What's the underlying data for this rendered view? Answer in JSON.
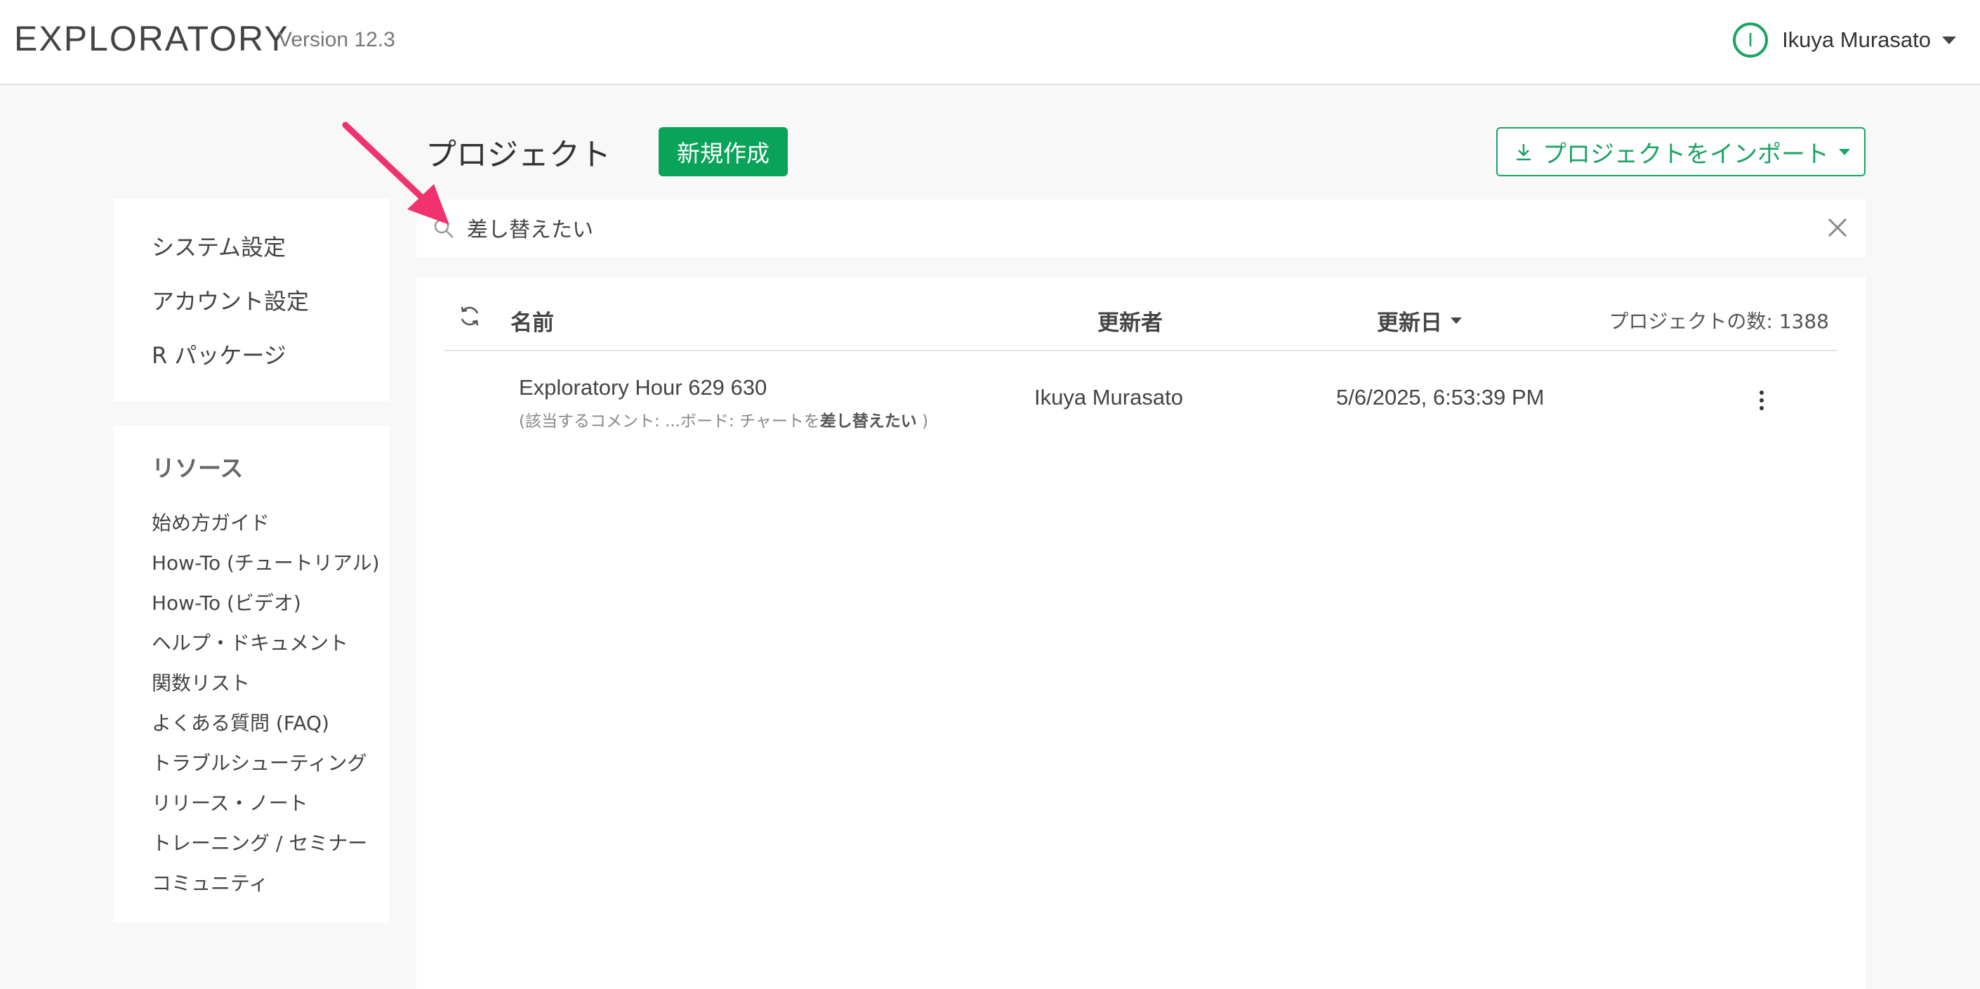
{
  "header": {
    "brand": "EXPLORATORY",
    "version": "Version 12.3",
    "user_initial": "I",
    "user_name": "Ikuya Murasato"
  },
  "sidebar": {
    "settings": [
      {
        "label": "システム設定"
      },
      {
        "label": "アカウント設定"
      },
      {
        "label": "R パッケージ"
      }
    ],
    "resources_title": "リソース",
    "resources": [
      {
        "label": "始め方ガイド"
      },
      {
        "label": "How-To (チュートリアル)"
      },
      {
        "label": "How-To (ビデオ)"
      },
      {
        "label": "ヘルプ・ドキュメント"
      },
      {
        "label": "関数リスト"
      },
      {
        "label": "よくある質問 (FAQ)"
      },
      {
        "label": "トラブルシューティング"
      },
      {
        "label": "リリース・ノート"
      },
      {
        "label": "トレーニング / セミナー"
      },
      {
        "label": "コミュニティ"
      }
    ]
  },
  "main": {
    "title": "プロジェクト",
    "new_button": "新規作成",
    "import_button": "プロジェクトをインポート",
    "search": {
      "value": "差し替えたい",
      "placeholder": ""
    },
    "columns": {
      "name": "名前",
      "updater": "更新者",
      "date": "更新日"
    },
    "project_count": "プロジェクトの数: 1388",
    "rows": [
      {
        "name": "Exploratory Hour 629 630",
        "comment_prefix": "(該当するコメント: ...ボード: チャートを",
        "comment_match": "差し替えたい",
        "comment_suffix": " )",
        "updater": "Ikuya Murasato",
        "date": "5/6/2025, 6:53:39 PM"
      }
    ]
  },
  "colors": {
    "accent": "#0aa35a",
    "annotation": "#f0336f"
  },
  "icons": [
    "user-avatar-icon",
    "caret-down-icon",
    "download-icon",
    "search-icon",
    "close-icon",
    "refresh-icon",
    "more-vertical-icon",
    "annotation-arrow-icon"
  ]
}
